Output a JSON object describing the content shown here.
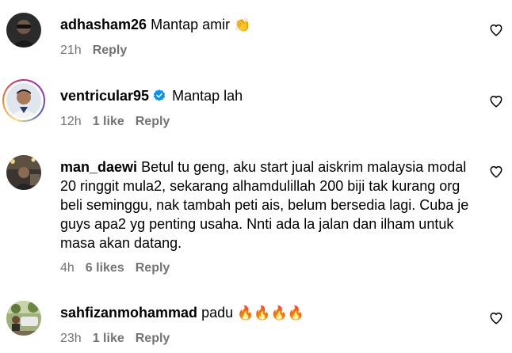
{
  "comments": [
    {
      "username": "adhasham26",
      "verified": false,
      "text": "Mantap amir",
      "emoji": "👏",
      "time": "21h",
      "likes": "",
      "reply_label": "Reply",
      "avatar": "avatar-sunglasses-man",
      "has_story_ring": false
    },
    {
      "username": "ventricular95",
      "verified": true,
      "text": "Mantap lah",
      "emoji": "",
      "time": "12h",
      "likes": "1 like",
      "reply_label": "Reply",
      "avatar": "avatar-man-portrait",
      "has_story_ring": true
    },
    {
      "username": "man_daewi",
      "verified": false,
      "text": "Betul tu geng, aku start jual aiskrim malaysia modal 20 ringgit mula2, sekarang alhamdulillah 200 biji tak kurang org beli seminggu, nak tambah peti ais, belum bersedia lagi. Cuba je guys apa2 yg penting usaha. Nnti ada la jalan dan ilham untuk masa akan datang.",
      "emoji": "",
      "time": "4h",
      "likes": "6 likes",
      "reply_label": "Reply",
      "avatar": "avatar-street-night",
      "has_story_ring": false
    },
    {
      "username": "sahfizanmohammad",
      "verified": false,
      "text": "padu",
      "emoji": "🔥🔥🔥🔥",
      "time": "23h",
      "likes": "1 like",
      "reply_label": "Reply",
      "avatar": "avatar-outdoor-car",
      "has_story_ring": false
    }
  ],
  "colors": {
    "meta_text": "#737373",
    "verified_badge": "#0095f6",
    "primary_text": "#000000"
  },
  "icons": {
    "like": "heart-outline-icon",
    "verified": "verified-badge-icon"
  }
}
